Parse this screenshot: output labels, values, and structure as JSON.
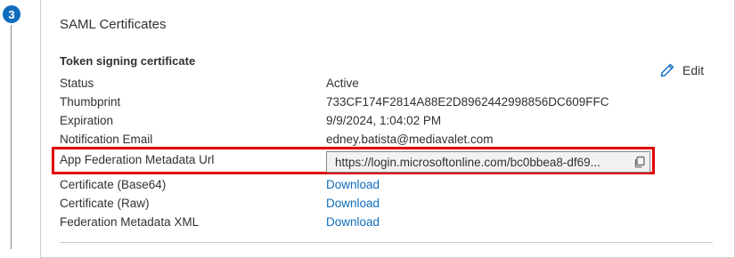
{
  "step": {
    "number": "3"
  },
  "card": {
    "title": "SAML Certificates",
    "edit_label": "Edit",
    "section_title": "Token signing certificate",
    "rows": [
      {
        "label": "Status",
        "value": "Active"
      },
      {
        "label": "Thumbprint",
        "value": "733CF174F2814A88E2D8962442998856DC609FFC"
      },
      {
        "label": "Expiration",
        "value": "9/9/2024, 1:04:02 PM"
      },
      {
        "label": "Notification Email",
        "value": "edney.batista@mediavalet.com"
      },
      {
        "label": "App Federation Metadata Url",
        "value": "https://login.microsoftonline.com/bc0bbea8-df69..."
      },
      {
        "label": "Certificate (Base64)",
        "value": "Download"
      },
      {
        "label": "Certificate (Raw)",
        "value": "Download"
      },
      {
        "label": "Federation Metadata XML",
        "value": "Download"
      }
    ]
  },
  "colors": {
    "accent": "#0f6cbd",
    "highlight": "#e00000"
  },
  "icons": {
    "edit": "pencil-icon",
    "copy": "copy-icon"
  }
}
